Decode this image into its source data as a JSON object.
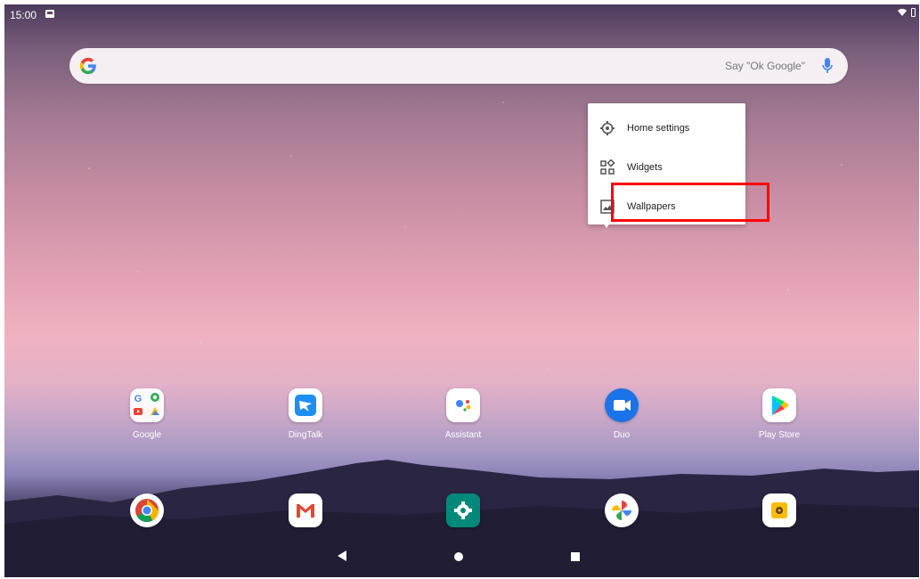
{
  "status_bar": {
    "time": "15:00"
  },
  "search": {
    "hint": "Say \"Ok Google\""
  },
  "popup_menu": {
    "items": [
      {
        "label": "Home settings",
        "icon": "gear-icon"
      },
      {
        "label": "Widgets",
        "icon": "widgets-icon"
      },
      {
        "label": "Wallpapers",
        "icon": "wallpaper-icon",
        "highlighted": true
      }
    ]
  },
  "apps_row": [
    {
      "label": "Google",
      "icon": "google-folder-icon"
    },
    {
      "label": "DingTalk",
      "icon": "dingtalk-icon"
    },
    {
      "label": "Assistant",
      "icon": "assistant-icon"
    },
    {
      "label": "Duo",
      "icon": "duo-icon"
    },
    {
      "label": "Play Store",
      "icon": "play-store-icon"
    }
  ],
  "dock": [
    {
      "icon": "chrome-icon"
    },
    {
      "icon": "gmail-icon"
    },
    {
      "icon": "settings-icon"
    },
    {
      "icon": "photos-icon"
    },
    {
      "icon": "camera-icon"
    }
  ],
  "colors": {
    "highlight": "#ff0000",
    "accent_blue": "#1a73e8"
  }
}
